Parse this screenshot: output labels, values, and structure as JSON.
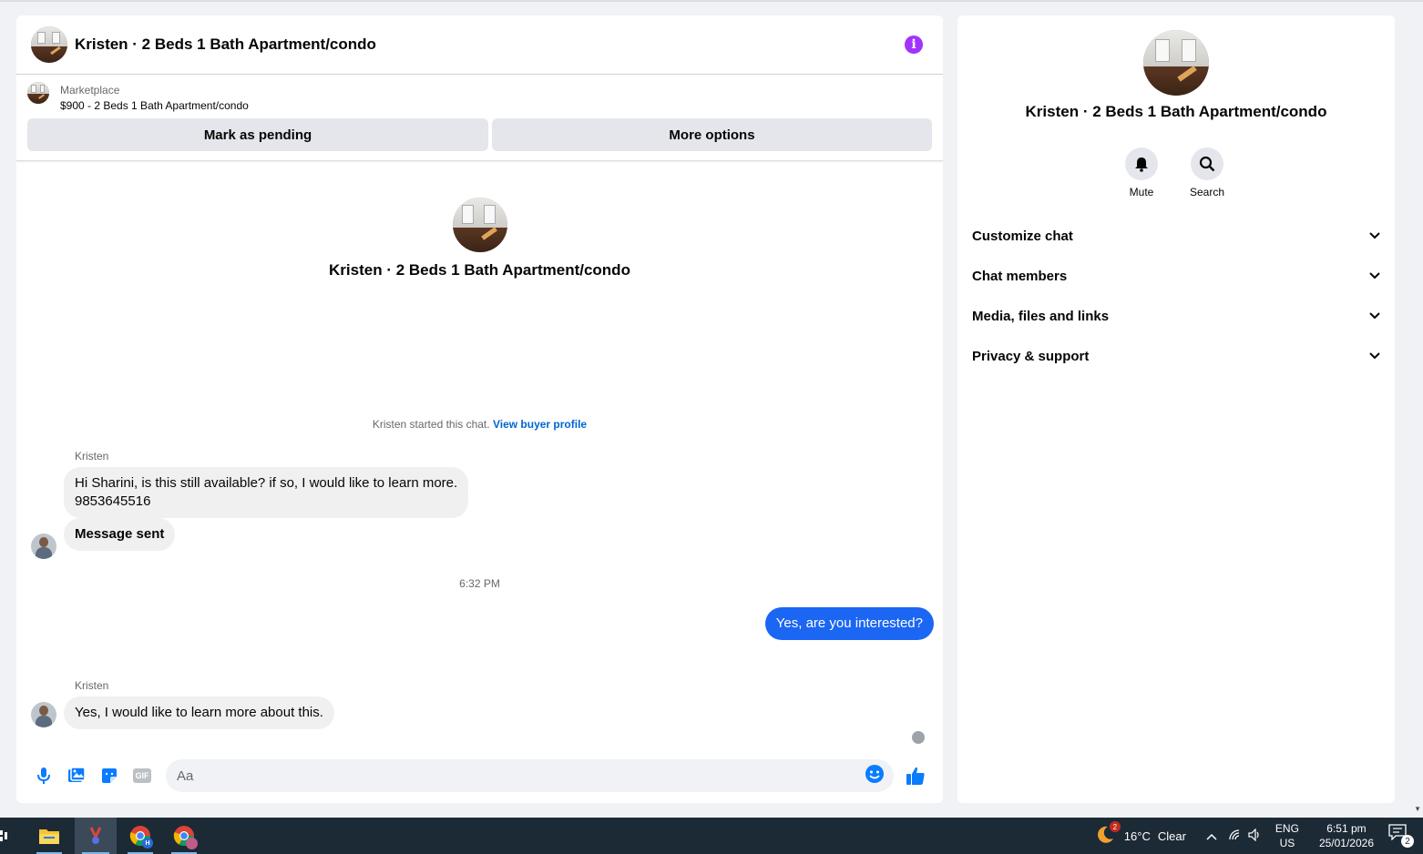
{
  "chat": {
    "header_title": "Kristen · 2 Beds 1 Bath Apartment/condo",
    "marketplace_label": "Marketplace",
    "listing": "$900 - 2 Beds 1 Bath Apartment/condo",
    "mark_pending_label": "Mark as pending",
    "more_options_label": "More options",
    "intro_title": "Kristen · 2 Beds 1 Bath Apartment/condo",
    "started_text": "Kristen started this chat.",
    "view_buyer_profile": "View buyer profile",
    "messages": [
      {
        "sender": "Kristen",
        "text": "Hi Sharini, is this still available? if so, I would like to learn more.",
        "text2": "9853645516"
      },
      {
        "text": "Message sent"
      },
      {
        "text": "Yes, are you interested?"
      },
      {
        "sender": "Kristen",
        "text": "Yes, I would like to learn more about this."
      }
    ],
    "timestamp": "6:32 PM",
    "composer_placeholder": "Aa",
    "gif_label": "GIF"
  },
  "info": {
    "title": "Kristen · 2 Beds 1 Bath Apartment/condo",
    "mute_label": "Mute",
    "search_label": "Search",
    "sections": [
      "Customize chat",
      "Chat members",
      "Media, files and links",
      "Privacy & support"
    ]
  },
  "taskbar": {
    "weather_temp": "16°C",
    "weather_cond": "Clear",
    "weather_badge": "2",
    "lang": "ENG",
    "region": "US",
    "time": "6:51 pm",
    "date": "25/01/2026",
    "notification_count": "2",
    "chrome_badge": "H"
  },
  "colors": {
    "accent": "#1b66f3",
    "info_purple": "#a033ff",
    "link": "#0064d1",
    "icon_blue": "#0a7cff"
  }
}
